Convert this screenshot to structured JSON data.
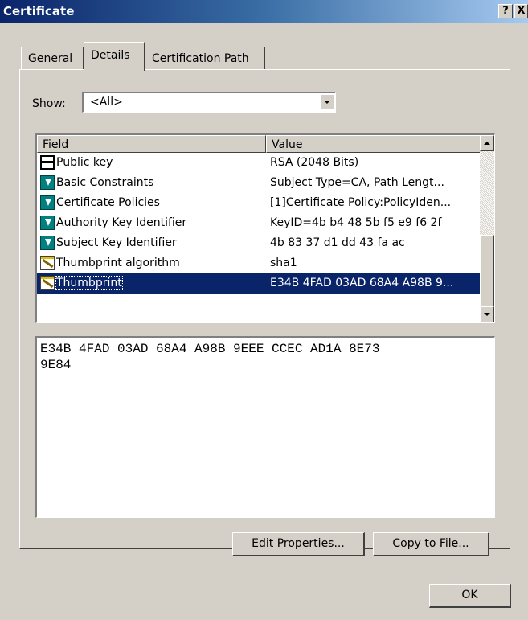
{
  "window": {
    "title": "Certificate",
    "help_label": "?",
    "close_label": "X"
  },
  "tabs": [
    {
      "label": "General",
      "active": false
    },
    {
      "label": "Details",
      "active": true
    },
    {
      "label": "Certification Path",
      "active": false
    }
  ],
  "show": {
    "label": "Show:",
    "value": "<All>"
  },
  "list": {
    "columns": [
      "Field",
      "Value"
    ],
    "rows": [
      {
        "icon": "public-key-icon",
        "field": "Public key",
        "value": "RSA (2048 Bits)"
      },
      {
        "icon": "extension-icon",
        "field": "Basic Constraints",
        "value": "Subject Type=CA, Path Lengt..."
      },
      {
        "icon": "extension-icon",
        "field": "Certificate Policies",
        "value": "[1]Certificate Policy:PolicyIden..."
      },
      {
        "icon": "extension-icon",
        "field": "Authority Key Identifier",
        "value": "KeyID=4b b4 48 5b f5 e9 f6 2f"
      },
      {
        "icon": "extension-icon",
        "field": "Subject Key Identifier",
        "value": "4b 83 37 d1 dd 43 fa ac"
      },
      {
        "icon": "property-icon",
        "field": "Thumbprint algorithm",
        "value": "sha1"
      },
      {
        "icon": "property-icon",
        "field": "Thumbprint",
        "value": "E34B 4FAD 03AD 68A4 A98B 9...",
        "selected": true
      }
    ]
  },
  "detail_text": "E34B 4FAD 03AD 68A4 A98B 9EEE CCEC AD1A 8E73\n9E84",
  "buttons": {
    "edit": "Edit Properties...",
    "copy": "Copy to File...",
    "ok": "OK"
  },
  "colors": {
    "title_bar": "#0a246a",
    "face": "#d4d0c8",
    "selection": "#0a246a"
  }
}
